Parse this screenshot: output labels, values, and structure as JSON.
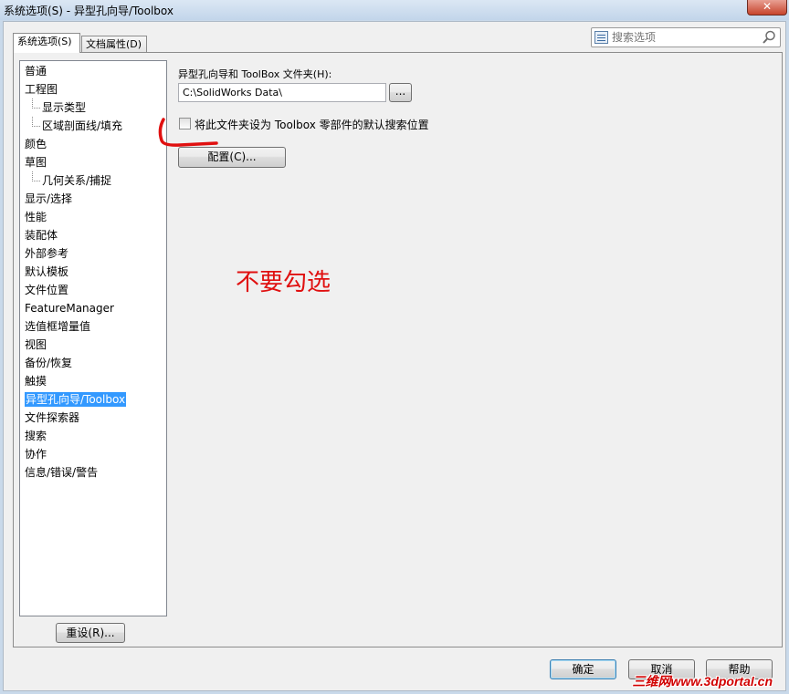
{
  "window": {
    "title": "系统选项(S) - 异型孔向导/Toolbox",
    "close_label": "✕"
  },
  "tabs": [
    {
      "label": "系统选项(S)",
      "active": true
    },
    {
      "label": "文档属性(D)",
      "active": false
    }
  ],
  "search": {
    "placeholder": "搜索选项"
  },
  "tree": [
    {
      "label": "普通",
      "child": false
    },
    {
      "label": "工程图",
      "child": false
    },
    {
      "label": "显示类型",
      "child": true
    },
    {
      "label": "区域剖面线/填充",
      "child": true
    },
    {
      "label": "颜色",
      "child": false
    },
    {
      "label": "草图",
      "child": false
    },
    {
      "label": "几何关系/捕捉",
      "child": true
    },
    {
      "label": "显示/选择",
      "child": false
    },
    {
      "label": "性能",
      "child": false
    },
    {
      "label": "装配体",
      "child": false
    },
    {
      "label": "外部参考",
      "child": false
    },
    {
      "label": "默认模板",
      "child": false
    },
    {
      "label": "文件位置",
      "child": false
    },
    {
      "label": "FeatureManager",
      "child": false
    },
    {
      "label": "选值框增量值",
      "child": false
    },
    {
      "label": "视图",
      "child": false
    },
    {
      "label": "备份/恢复",
      "child": false
    },
    {
      "label": "触摸",
      "child": false
    },
    {
      "label": "异型孔向导/Toolbox",
      "child": false,
      "selected": true
    },
    {
      "label": "文件探索器",
      "child": false
    },
    {
      "label": "搜索",
      "child": false
    },
    {
      "label": "协作",
      "child": false
    },
    {
      "label": "信息/错误/警告",
      "child": false
    }
  ],
  "panel": {
    "folder_label": "异型孔向导和 ToolBox 文件夹(H):",
    "folder_value": "C:\\SolidWorks Data\\",
    "browse_label": "...",
    "checkbox_label": "将此文件夹设为 Toolbox 零部件的默认搜索位置",
    "checkbox_checked": false,
    "configure_label": "配置(C)..."
  },
  "annotation": {
    "text": "不要勾选",
    "color": "#e01010"
  },
  "buttons": {
    "reset": "重设(R)...",
    "ok": "确定",
    "cancel": "取消",
    "help": "帮助"
  },
  "watermark": "三维网www.3dportal.cn",
  "colors": {
    "selection": "#3399ff",
    "annotation": "#e01010",
    "close_button": "#c7432b"
  }
}
